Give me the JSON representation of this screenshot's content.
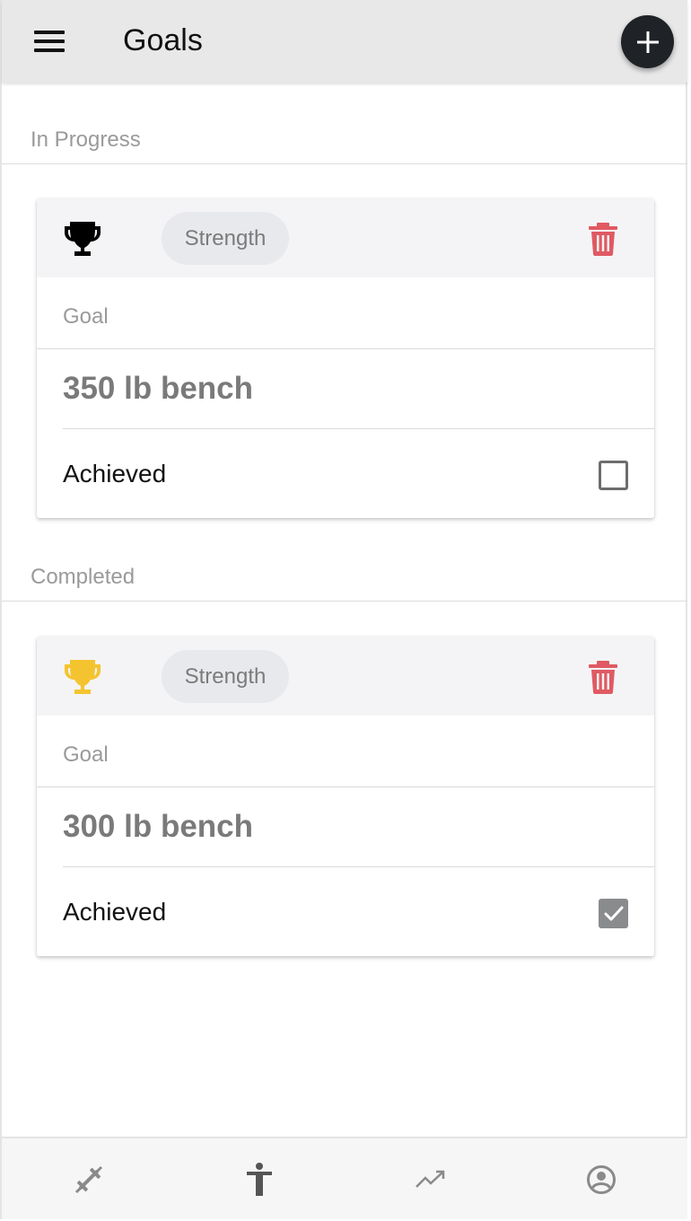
{
  "header": {
    "title": "Goals",
    "menu_icon": "hamburger-menu-icon",
    "add_icon": "plus-icon"
  },
  "sections": [
    {
      "label": "In Progress",
      "goals": [
        {
          "category": "Strength",
          "trophy_color": "#000000",
          "goal_label": "Goal",
          "goal_value": "350 lb bench",
          "achieved_label": "Achieved",
          "achieved": false
        }
      ]
    },
    {
      "label": "Completed",
      "goals": [
        {
          "category": "Strength",
          "trophy_color": "#f4c430",
          "goal_label": "Goal",
          "goal_value": "300 lb bench",
          "achieved_label": "Achieved",
          "achieved": true
        }
      ]
    }
  ],
  "colors": {
    "delete": "#e05a63",
    "header_bg": "#e8e8e8",
    "fab": "#1f2226"
  },
  "bottom_nav": {
    "items": [
      "workouts-icon",
      "body-icon",
      "progress-trend-icon",
      "profile-icon"
    ]
  }
}
